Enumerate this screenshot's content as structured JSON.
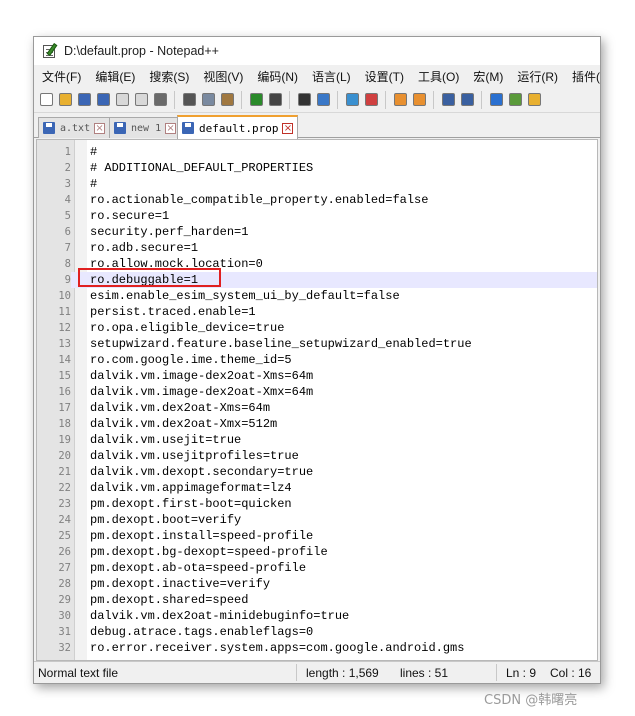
{
  "window": {
    "title": "D:\\default.prop - Notepad++"
  },
  "menu": [
    "文件(F)",
    "编辑(E)",
    "搜索(S)",
    "视图(V)",
    "编码(N)",
    "语言(L)",
    "设置(T)",
    "工具(O)",
    "宏(M)",
    "运行(R)",
    "插件("
  ],
  "toolbar_icons": [
    {
      "name": "new-file-icon",
      "color": "#ffffff"
    },
    {
      "name": "open-file-icon",
      "color": "#e8b030"
    },
    {
      "name": "save-icon",
      "color": "#3b66b5"
    },
    {
      "name": "save-all-icon",
      "color": "#3b66b5"
    },
    {
      "name": "close-icon",
      "color": "#d8d8d8"
    },
    {
      "name": "close-all-icon",
      "color": "#d8d8d8"
    },
    {
      "name": "print-icon",
      "color": "#6a6a6a"
    },
    {
      "name": "cut-icon",
      "color": "#555555"
    },
    {
      "name": "copy-icon",
      "color": "#7a8aa0"
    },
    {
      "name": "paste-icon",
      "color": "#a07840"
    },
    {
      "name": "undo-icon",
      "color": "#2a8a2a"
    },
    {
      "name": "redo-icon",
      "color": "#444444"
    },
    {
      "name": "find-icon",
      "color": "#333333"
    },
    {
      "name": "replace-icon",
      "color": "#3a78c8"
    },
    {
      "name": "zoom-in-icon",
      "color": "#3a90d0"
    },
    {
      "name": "zoom-out-icon",
      "color": "#d04040"
    },
    {
      "name": "sync-vertical-icon",
      "color": "#e89030"
    },
    {
      "name": "sync-horizontal-icon",
      "color": "#e89030"
    },
    {
      "name": "word-wrap-icon",
      "color": "#3a60a0"
    },
    {
      "name": "show-all-chars-icon",
      "color": "#3a60a0"
    },
    {
      "name": "indent-guide-icon",
      "color": "#2a70d0"
    },
    {
      "name": "doc-map-icon",
      "color": "#5a9a3a"
    },
    {
      "name": "function-list-icon",
      "color": "#e8b030"
    }
  ],
  "tabs": [
    {
      "label": "a.txt",
      "state": "inactive"
    },
    {
      "label": "new 1",
      "state": "inactive"
    },
    {
      "label": "default.prop",
      "state": "active"
    }
  ],
  "editor": {
    "current_line": 9,
    "lines": [
      {
        "n": "1",
        "text": "#"
      },
      {
        "n": "2",
        "text": "# ADDITIONAL_DEFAULT_PROPERTIES"
      },
      {
        "n": "3",
        "text": "#"
      },
      {
        "n": "4",
        "text": "ro.actionable_compatible_property.enabled=false"
      },
      {
        "n": "5",
        "text": "ro.secure=1"
      },
      {
        "n": "6",
        "text": "security.perf_harden=1"
      },
      {
        "n": "7",
        "text": "ro.adb.secure=1"
      },
      {
        "n": "8",
        "text": "ro.allow.mock.location=0"
      },
      {
        "n": "9",
        "text": "ro.debuggable=1"
      },
      {
        "n": "10",
        "text": "esim.enable_esim_system_ui_by_default=false"
      },
      {
        "n": "11",
        "text": "persist.traced.enable=1"
      },
      {
        "n": "12",
        "text": "ro.opa.eligible_device=true"
      },
      {
        "n": "13",
        "text": "setupwizard.feature.baseline_setupwizard_enabled=true"
      },
      {
        "n": "14",
        "text": "ro.com.google.ime.theme_id=5"
      },
      {
        "n": "15",
        "text": "dalvik.vm.image-dex2oat-Xms=64m"
      },
      {
        "n": "16",
        "text": "dalvik.vm.image-dex2oat-Xmx=64m"
      },
      {
        "n": "17",
        "text": "dalvik.vm.dex2oat-Xms=64m"
      },
      {
        "n": "18",
        "text": "dalvik.vm.dex2oat-Xmx=512m"
      },
      {
        "n": "19",
        "text": "dalvik.vm.usejit=true"
      },
      {
        "n": "20",
        "text": "dalvik.vm.usejitprofiles=true"
      },
      {
        "n": "21",
        "text": "dalvik.vm.dexopt.secondary=true"
      },
      {
        "n": "22",
        "text": "dalvik.vm.appimageformat=lz4"
      },
      {
        "n": "23",
        "text": "pm.dexopt.first-boot=quicken"
      },
      {
        "n": "24",
        "text": "pm.dexopt.boot=verify"
      },
      {
        "n": "25",
        "text": "pm.dexopt.install=speed-profile"
      },
      {
        "n": "26",
        "text": "pm.dexopt.bg-dexopt=speed-profile"
      },
      {
        "n": "27",
        "text": "pm.dexopt.ab-ota=speed-profile"
      },
      {
        "n": "28",
        "text": "pm.dexopt.inactive=verify"
      },
      {
        "n": "29",
        "text": "pm.dexopt.shared=speed"
      },
      {
        "n": "30",
        "text": "dalvik.vm.dex2oat-minidebuginfo=true"
      },
      {
        "n": "31",
        "text": "debug.atrace.tags.enableflags=0"
      },
      {
        "n": "32",
        "text": "ro.error.receiver.system.apps=com.google.android.gms"
      }
    ]
  },
  "annotation": {
    "highlight_color": "#e02020"
  },
  "status": {
    "file_type": "Normal text file",
    "length": "length : 1,569",
    "lines": "lines : 51",
    "ln": "Ln : 9",
    "col": "Col : 16"
  },
  "watermark": "CSDN @韩曙亮"
}
